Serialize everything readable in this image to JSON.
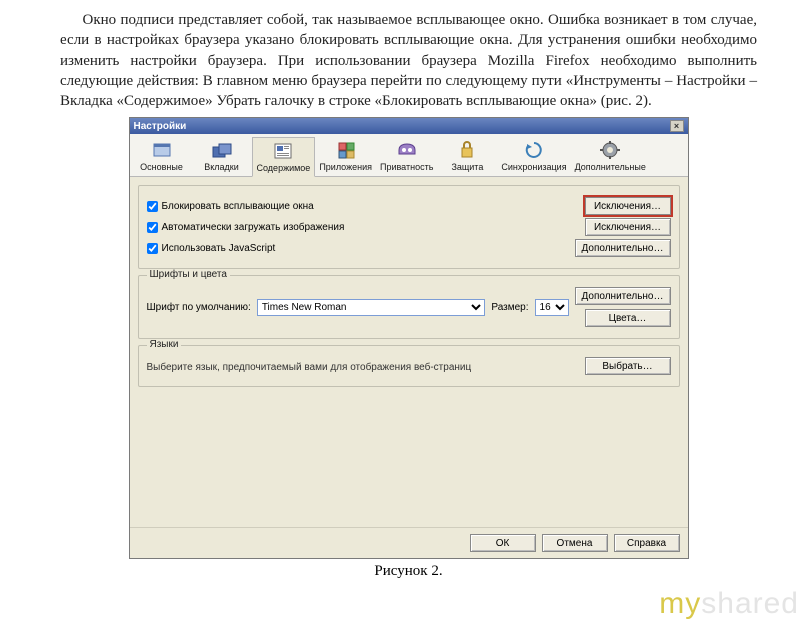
{
  "intro": {
    "text": "Окно подписи представляет собой, так называемое всплывающее окно. Ошибка возникает в том случае, если в настройках браузера указано блокировать всплывающие окна. Для устранения ошибки необходимо изменить настройки браузера. При использовании браузера Mozilla Firefox необходимо выполнить следующие действия: В главном меню браузера перейти по следующему пути «Инструменты – Настройки – Вкладка «Содержимое» Убрать галочку в строке «Блокировать всплывающие окна» (рис. 2)."
  },
  "dialog": {
    "title": "Настройки",
    "close": "×",
    "tabs": [
      {
        "label": "Основные"
      },
      {
        "label": "Вкладки"
      },
      {
        "label": "Содержимое"
      },
      {
        "label": "Приложения"
      },
      {
        "label": "Приватность"
      },
      {
        "label": "Защита"
      },
      {
        "label": "Синхронизация"
      },
      {
        "label": "Дополнительные"
      }
    ],
    "content": {
      "block_popups": "Блокировать всплывающие окна",
      "load_images": "Автоматически загружать изображения",
      "use_js": "Использовать JavaScript",
      "exceptions": "Исключения…",
      "advanced": "Дополнительно…"
    },
    "fonts": {
      "title": "Шрифты и цвета",
      "default_font_label": "Шрифт по умолчанию:",
      "font_value": "Times New Roman",
      "size_label": "Размер:",
      "size_value": "16",
      "advanced": "Дополнительно…",
      "colors": "Цвета…"
    },
    "languages": {
      "title": "Языки",
      "desc": "Выберите язык, предпочитаемый вами для отображения веб-страниц",
      "choose": "Выбрать…"
    },
    "buttons": {
      "ok": "ОК",
      "cancel": "Отмена",
      "help": "Справка"
    }
  },
  "caption": "Рисунок 2.",
  "watermark_a": "my",
  "watermark_b": "shared"
}
